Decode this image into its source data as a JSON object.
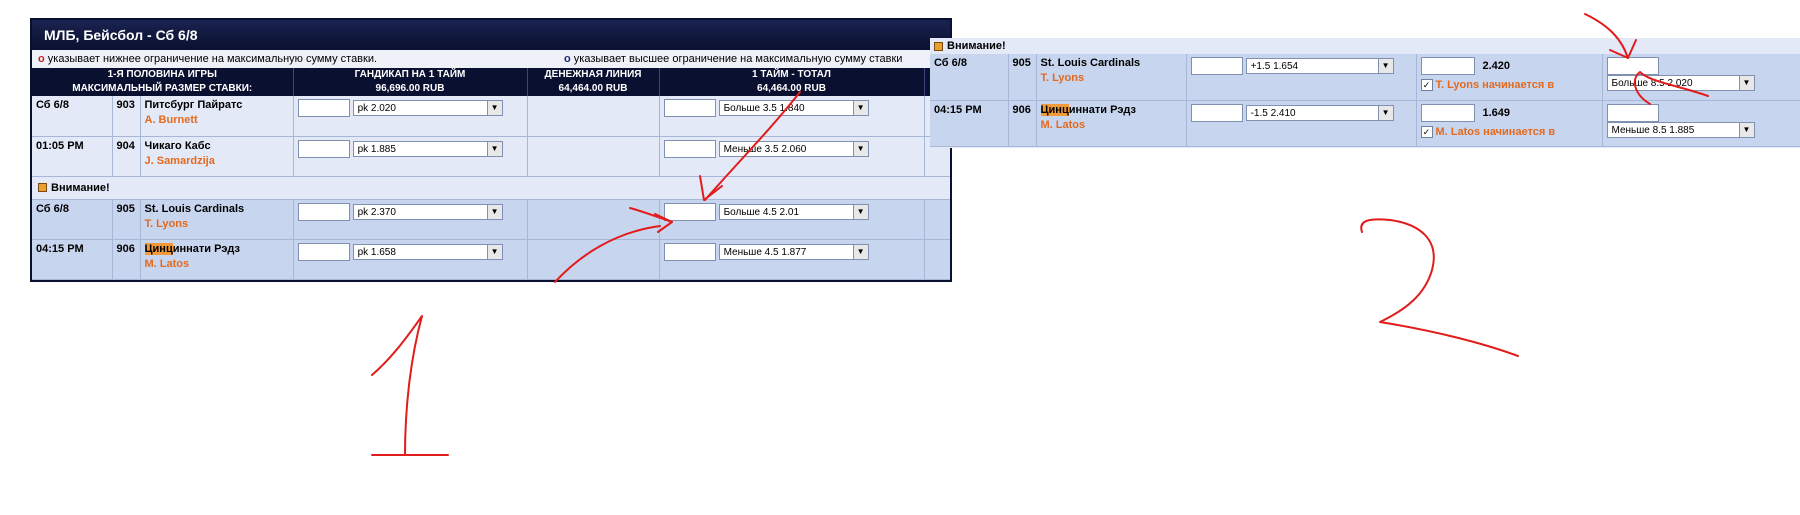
{
  "shot1": {
    "title": "МЛБ, Бейсбол - Сб 6/8",
    "notice_left_marker": "о",
    "notice_left": "указывает нижнее ограничение на максимальную сумму ставки.",
    "notice_right_marker": "о",
    "notice_right": "указывает высшее ограничение на максимальную сумму ставки",
    "header1": [
      "1-Я ПОЛОВИНА ИГРЫ",
      "ГАНДИКАП НА 1 ТАЙМ",
      "ДЕНЕЖНАЯ ЛИНИЯ",
      "1 ТАЙМ - ТОТАЛ"
    ],
    "header2": [
      "МАКСИМАЛЬНЫЙ РАЗМЕР СТАВКИ:",
      "96,696.00 RUB",
      "64,464.00 RUB",
      "64,464.00 RUB"
    ],
    "game1": {
      "rows": [
        {
          "date": "Сб 6/8",
          "num": "903",
          "team": "Питсбург Пайратс",
          "pitcher": "A. Burnett",
          "handicap": "pk   2.020",
          "total": "Больше 3.5   1.840"
        },
        {
          "date": "01:05 PM",
          "num": "904",
          "team": "Чикаго Кабс",
          "pitcher": "J. Samardzija",
          "handicap": "pk   1.885",
          "total": "Меньше 3.5   2.060"
        }
      ]
    },
    "warning": "Внимание!",
    "game2": {
      "rows": [
        {
          "date": "Сб 6/8",
          "num": "905",
          "team": "St. Louis Cardinals",
          "pitcher": "T. Lyons",
          "handicap": "pk   2.370",
          "total": "Больше 4.5   2.01"
        },
        {
          "date": "04:15 PM",
          "num": "906",
          "team_hl": "Цинц",
          "team_rest": "иннати Рэдз",
          "pitcher": "M. Latos",
          "handicap": "pk   1.658",
          "total": "Меньше 4.5   1.877"
        }
      ]
    }
  },
  "shot2": {
    "warning": "Внимание!",
    "rows": [
      {
        "date": "Сб 6/8",
        "num": "905",
        "team": "St. Louis Cardinals",
        "pitcher": "T. Lyons",
        "handicap": "+1.5   1.654",
        "moneyline": "2.420",
        "starts": "T. Lyons начинается в",
        "total": "Больше 8.5   2.020"
      },
      {
        "date": "04:15 PM",
        "num": "906",
        "team_hl": "Цинц",
        "team_rest": "иннати Рэдз",
        "pitcher": "M. Latos",
        "handicap": "-1.5   2.410",
        "moneyline": "1.649",
        "starts": "M. Latos начинается в",
        "total": "Меньше 8.5   1.885"
      }
    ]
  },
  "annotations": {
    "label1": "1",
    "label2": "2",
    "color": "#e21b1b"
  },
  "icons": {
    "dropdown_arrow": "▼",
    "checkmark": "✓"
  }
}
